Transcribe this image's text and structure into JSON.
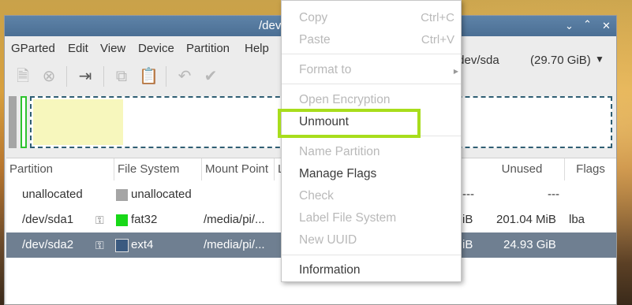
{
  "window": {
    "title": "/dev/sda - GParted",
    "title_visible": "/dev",
    "controls": [
      "chevron-down-icon",
      "chevron-up-icon",
      "close-icon"
    ]
  },
  "menubar": [
    "GParted",
    "Edit",
    "View",
    "Device",
    "Partition",
    "Help"
  ],
  "device_selector": {
    "device": "/dev/sda",
    "size": "(29.70 GiB)"
  },
  "table": {
    "headers": {
      "partition": "Partition",
      "file_system": "File System",
      "mount_point": "Mount Point",
      "label_partial": "L",
      "unused": "Unused",
      "flags": "Flags"
    },
    "rows": [
      {
        "partition": "unallocated",
        "key": "",
        "fs": "unallocated",
        "fs_color": "#a5a5a5",
        "mount": "",
        "label": "",
        "used": "---",
        "unused": "---",
        "flags": ""
      },
      {
        "partition": "/dev/sda1",
        "key": "⚿",
        "fs": "fat32",
        "fs_color": "#18d818",
        "mount": "/media/pi/...",
        "label": "l",
        "used": "iB",
        "unused": "201.04 MiB",
        "flags": "lba"
      },
      {
        "partition": "/dev/sda2",
        "key": "⚿",
        "fs": "ext4",
        "fs_color": "#3b5a80",
        "mount": "/media/pi/...",
        "label": "l",
        "used": "iB",
        "unused": "24.93 GiB",
        "flags": ""
      }
    ],
    "selected_row": 2
  },
  "context_menu": {
    "copy": {
      "label": "Copy",
      "accel": "Ctrl+C"
    },
    "paste": {
      "label": "Paste",
      "accel": "Ctrl+V"
    },
    "format_to": "Format to",
    "open_encryption": "Open Encryption",
    "unmount": "Unmount",
    "name_partition": "Name Partition",
    "manage_flags": "Manage Flags",
    "check": "Check",
    "label_file_system": "Label File System",
    "new_uuid": "New UUID",
    "information": "Information"
  },
  "colors": {
    "highlight": "#a8dd1c",
    "titlebar": "#5277a0",
    "selected_row": "#6f7f91"
  }
}
